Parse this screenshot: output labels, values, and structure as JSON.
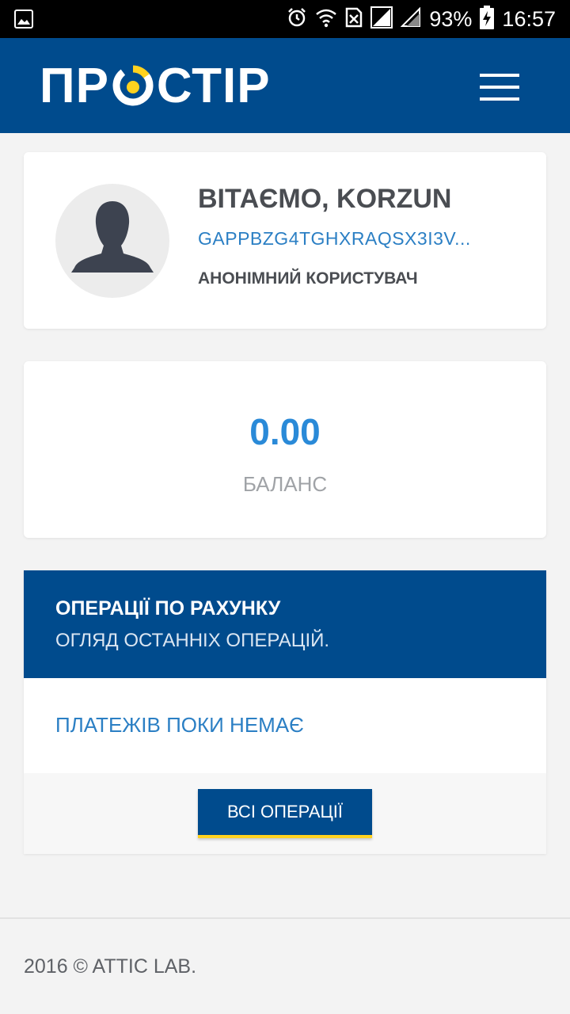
{
  "status_bar": {
    "battery": "93%",
    "time": "16:57",
    "icons": [
      "image-icon",
      "alarm-icon",
      "wifi-icon",
      "sim-icon",
      "signal-icon",
      "signal-icon",
      "battery-charging-icon"
    ]
  },
  "header": {
    "logo": {
      "part1": "ПР",
      "part2": "СТІР"
    },
    "menu_icon": "hamburger-menu-icon"
  },
  "profile": {
    "greeting": "ВІТАЄМО, KORZUN",
    "account_id": "GAPPBZG4TGHXRAQSX3I3V...",
    "user_type": "АНОНІМНИЙ КОРИСТУВАЧ",
    "avatar_icon": "user-avatar-icon"
  },
  "balance": {
    "value": "0.00",
    "label": "БАЛАНС"
  },
  "operations": {
    "title": "ОПЕРАЦІЇ ПО РАХУНКУ",
    "subtitle": "ОГЛЯД ОСТАННІХ ОПЕРАЦІЙ.",
    "empty_text": "ПЛАТЕЖІВ ПОКИ НЕМАЄ",
    "button_label": "ВСІ ОПЕРАЦІЇ"
  },
  "footer": {
    "copyright": "2016 © ATTIC LAB."
  },
  "colors": {
    "brand_blue": "#004b8d",
    "accent_yellow": "#ffd21f",
    "link_blue": "#2b7fc4",
    "balance_blue": "#2a8ad8"
  }
}
